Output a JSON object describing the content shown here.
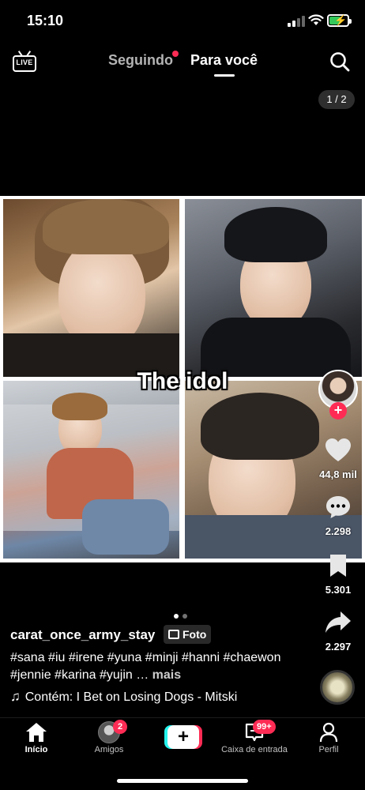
{
  "status_bar": {
    "time": "15:10",
    "battery_color": "#34c759"
  },
  "top_nav": {
    "live_label": "LIVE",
    "tabs": [
      {
        "label": "Seguindo",
        "has_dot": true
      },
      {
        "label": "Para você",
        "active": true
      }
    ],
    "search_icon": "search-icon"
  },
  "post": {
    "counter": "1 / 2",
    "overlay_text": "The idol",
    "username": "carat_once_army_stay",
    "type_tag": "Foto",
    "caption": "#sana #iu #irene #yuna #minji #hanni #chaewon #jennie #karina #yujin …",
    "more_label": "mais",
    "music": "Contém: I Bet on Losing Dogs - Mitski",
    "slides": 2,
    "current_slide": 1
  },
  "actions": {
    "likes": "44,8 mil",
    "comments": "2.298",
    "saves": "5.301",
    "shares": "2.297"
  },
  "bottom_nav": {
    "items": [
      {
        "label": "Início",
        "icon": "home-icon",
        "active": true
      },
      {
        "label": "Amigos",
        "icon": "friends-avatar",
        "badge": "2"
      },
      {
        "label": "",
        "icon": "create-plus-icon"
      },
      {
        "label": "Caixa de entrada",
        "icon": "inbox-icon",
        "badge": "99+"
      },
      {
        "label": "Perfil",
        "icon": "profile-icon"
      }
    ]
  },
  "colors": {
    "accent": "#fe2c55",
    "cyan": "#25f4ee",
    "background": "#000000"
  }
}
